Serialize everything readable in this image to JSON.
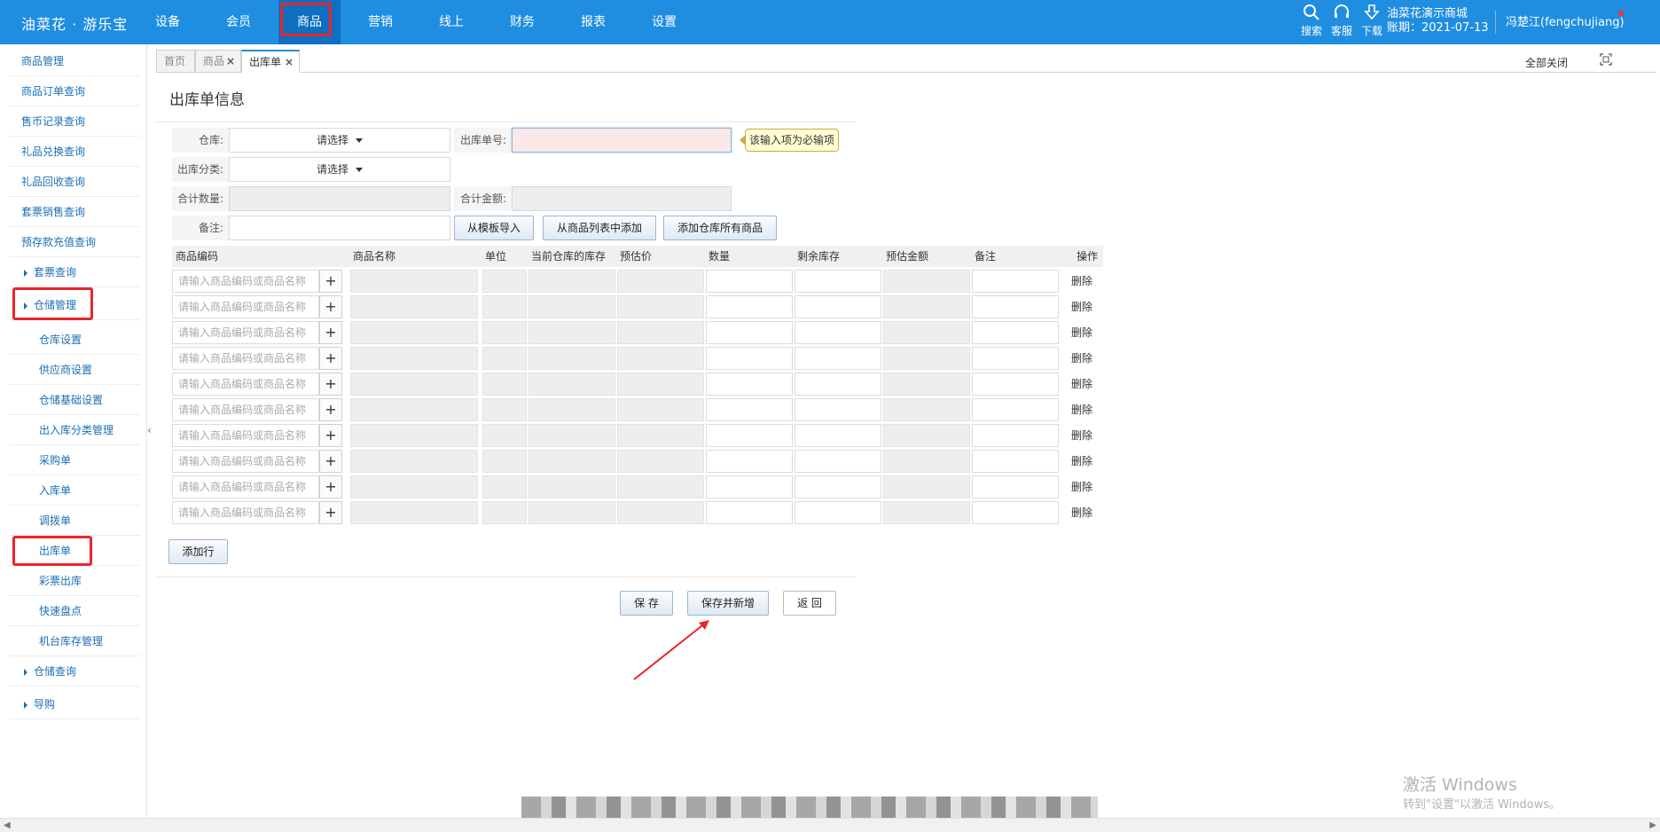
{
  "brand": "油菜花 · 游乐宝",
  "top_nav": [
    "设备",
    "会员",
    "商品",
    "营销",
    "线上",
    "财务",
    "报表",
    "设置"
  ],
  "top_tools": {
    "search": "搜索",
    "service": "客服",
    "download": "下载"
  },
  "store": {
    "name": "油菜花演示商城",
    "date": "账期：2021-07-13"
  },
  "user": "冯楚江(fengchujiang)",
  "sidebar": {
    "top_items": [
      "商品管理",
      "商品订单查询",
      "售币记录查询",
      "礼品兑换查询",
      "礼品回收查询",
      "套票销售查询",
      "预存款充值查询"
    ],
    "group_ticket": "套票查询",
    "group_storage": "仓储管理",
    "storage_items": [
      "仓库设置",
      "供应商设置",
      "仓储基础设置",
      "出入库分类管理",
      "采购单",
      "入库单",
      "调拨单",
      "出库单",
      "彩票出库",
      "快速盘点",
      "机台库存管理"
    ],
    "group_query": "仓储查询",
    "group_guide": "导购"
  },
  "tabs": [
    "首页",
    "商品",
    "出库单"
  ],
  "close_all": "全部关闭",
  "page_title": "出库单信息",
  "form": {
    "warehouse_label": "仓库:",
    "warehouse_value": "请选择",
    "order_no_label": "出库单号:",
    "required_tip": "该输入项为必输项",
    "category_label": "出库分类:",
    "category_value": "请选择",
    "total_qty_label": "合计数量:",
    "total_amt_label": "合计金额:",
    "remark_label": "备注:",
    "btn_template": "从模板导入",
    "btn_from_list": "从商品列表中添加",
    "btn_add_all": "添加仓库所有商品"
  },
  "grid": {
    "headers": [
      "商品编码",
      "商品名称",
      "单位",
      "当前仓库的库存",
      "预估价",
      "数量",
      "剩余库存",
      "预估金额",
      "备注",
      "操作"
    ],
    "code_placeholder": "请输入商品编码或商品名称",
    "delete_label": "删除",
    "plus": "+",
    "row_count": 10
  },
  "add_row": "添加行",
  "actions": {
    "save": "保 存",
    "save_new": "保存并新增",
    "back": "返 回"
  },
  "watermark": {
    "line1": "激活 Windows",
    "line2": "转到\"设置\"以激活 Windows。"
  },
  "colors": {
    "topbar": "#1f8ee0",
    "link": "#1a6fb4",
    "highlight": "#e8262c",
    "tip_bg": "#ffffd2"
  }
}
